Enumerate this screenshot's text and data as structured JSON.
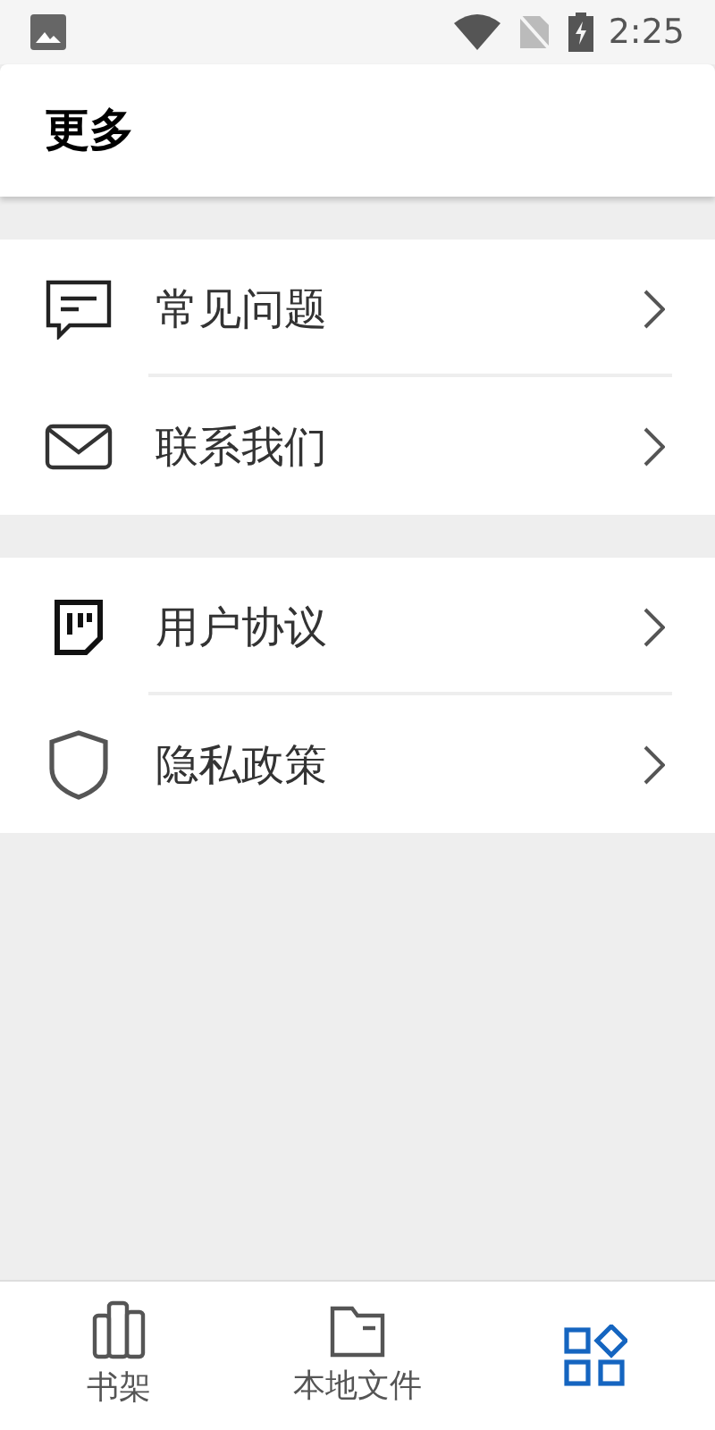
{
  "status_bar": {
    "time": "2:25"
  },
  "header": {
    "title": "更多"
  },
  "sections": [
    {
      "items": [
        {
          "kind": "faq",
          "label": "常见问题"
        },
        {
          "kind": "mail",
          "label": "联系我们"
        }
      ]
    },
    {
      "items": [
        {
          "kind": "agreement",
          "label": "用户协议"
        },
        {
          "kind": "privacy",
          "label": "隐私政策"
        }
      ]
    }
  ],
  "bottom_nav": [
    {
      "kind": "shelf",
      "label": "书架",
      "selected": false
    },
    {
      "kind": "files",
      "label": "本地文件",
      "selected": false
    },
    {
      "kind": "more",
      "selected": true
    }
  ]
}
